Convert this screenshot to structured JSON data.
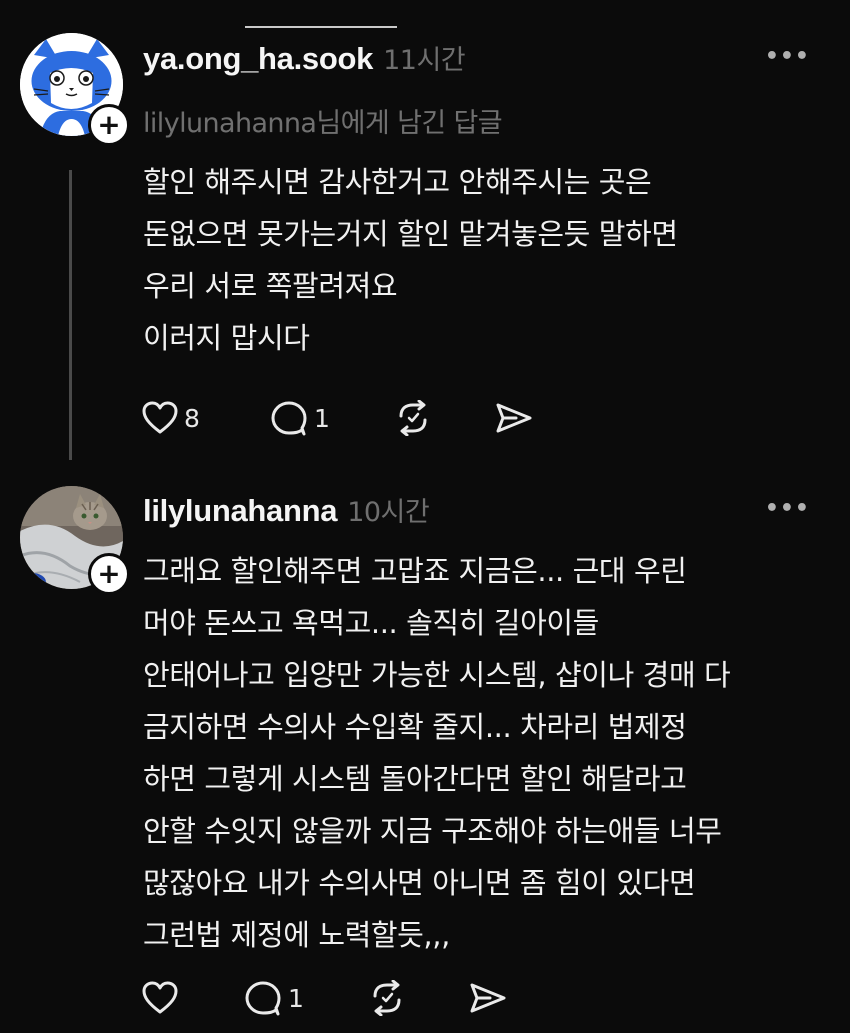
{
  "posts": [
    {
      "username": "ya.ong_ha.sook",
      "time": "11시간",
      "reply_to": "lilylunahanna님에게 남긴 답글",
      "body_lines": [
        "할인 해주시면 감사한거고 안해주시는 곳은",
        "돈없으면 못가는거지 할인 맡겨놓은듯 말하면",
        "우리 서로 쪽팔려져요",
        "이러지 맙시다"
      ],
      "like_count": "8",
      "reply_count": "1",
      "more": "•••"
    },
    {
      "username": "lilylunahanna",
      "time": "10시간",
      "body_lines": [
        "그래요 할인해주면 고맙죠 지금은... 근대 우린",
        "머야 돈쓰고 욕먹고... 솔직히 길아이들",
        "안태어나고 입양만 가능한 시스템, 샵이나 경매 다",
        "금지하면 수의사 수입확 줄지... 차라리 법제정",
        "하면 그렇게 시스템 돌아간다면 할인 해달라고",
        "안할 수잇지 않을까 지금 구조해야 하는애들 너무",
        "많잖아요 내가 수의사면 아니면 좀 힘이 있다면",
        "그런법 제정에 노력할듯,,,"
      ],
      "like_count": "",
      "reply_count": "1",
      "more": "•••"
    }
  ],
  "follow_symbol": "+",
  "icons": [
    "heart-icon",
    "comment-icon",
    "repost-icon",
    "share-icon",
    "more-icon",
    "follow-plus-icon"
  ]
}
